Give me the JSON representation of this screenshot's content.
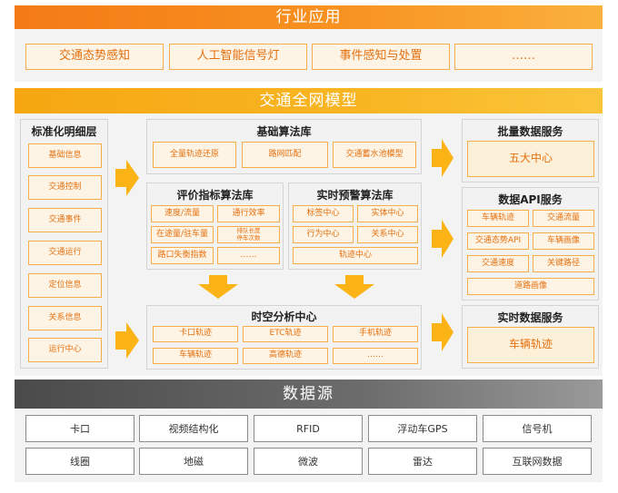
{
  "industry": {
    "title": "行业应用",
    "items": [
      "交通态势感知",
      "人工智能信号灯",
      "事件感知与处置",
      "……"
    ]
  },
  "model": {
    "title": "交通全网模型",
    "standard": {
      "title": "标准化明细层",
      "items": [
        "基础信息",
        "交通控制",
        "交通事件",
        "交通运行",
        "定位信息",
        "关系信息",
        "运行中心"
      ]
    },
    "base_algo": {
      "title": "基础算法库",
      "items": [
        "全量轨迹还原",
        "路网匹配",
        "交通蓄水池模型"
      ]
    },
    "eval_algo": {
      "title": "评价指标算法库",
      "items": [
        "速度/流量",
        "通行效率",
        "在途量/驻车量",
        "排队长度\n停车次数",
        "路口失衡指数",
        "……"
      ]
    },
    "alert_algo": {
      "title": "实时预警算法库",
      "items": [
        "标签中心",
        "实体中心",
        "行为中心",
        "关系中心",
        "轨迹中心"
      ]
    },
    "spatio": {
      "title": "时空分析中心",
      "items": [
        "卡口轨迹",
        "ETC轨迹",
        "手机轨迹",
        "车辆轨迹",
        "高德轨迹",
        "……"
      ]
    },
    "batch": {
      "title": "批量数据服务",
      "item": "五大中心"
    },
    "api": {
      "title": "数据API服务",
      "items": [
        "车辆轨迹",
        "交通流量",
        "交通态势API",
        "车辆画像",
        "交通速度",
        "关键路径",
        "道路画像"
      ]
    },
    "realtime": {
      "title": "实时数据服务",
      "item": "车辆轨迹"
    }
  },
  "sources": {
    "title": "数据源",
    "items": [
      "卡口",
      "视频结构化",
      "RFID",
      "浮动车GPS",
      "信号机",
      "线圈",
      "地磁",
      "微波",
      "雷达",
      "互联网数据"
    ]
  },
  "colors": {
    "accent_orange": "#f47a16",
    "accent_gold": "#f6a712",
    "arrow": "#fbb316",
    "box_text": "#e5700f",
    "dark_band": "#4a4a4a"
  }
}
